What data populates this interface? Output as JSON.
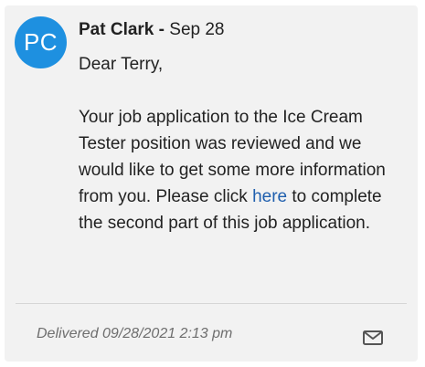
{
  "message": {
    "avatar_initials": "PC",
    "sender": "Pat Clark",
    "separator": "-",
    "date": "Sep 28",
    "greeting": "Dear Terry,",
    "body_before_link": "Your job application to the Ice Cream Tester position was reviewed and we would like to get some more information from you. Please click ",
    "link_text": "here",
    "body_after_link": " to complete the second part of this job application."
  },
  "footer": {
    "status": "Delivered 09/28/2021 2:13 pm",
    "icon": "envelope-icon"
  },
  "colors": {
    "avatar_bg": "#1e90e0",
    "link": "#1f5fae",
    "card_bg": "#f2f2f2"
  }
}
